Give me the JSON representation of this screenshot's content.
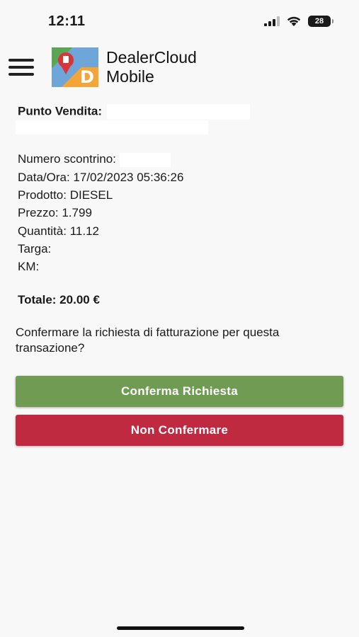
{
  "status_bar": {
    "time": "12:11",
    "battery": "28"
  },
  "header": {
    "title_line1": "DealerCloud",
    "title_line2": "Mobile"
  },
  "transaction": {
    "punto_vendita_label": "Punto Vendita:",
    "numero_scontrino_label": "Numero scontrino:",
    "data_ora": "Data/Ora: 17/02/2023 05:36:26",
    "prodotto": "Prodotto: DIESEL",
    "prezzo": "Prezzo: 1.799",
    "quantita": "Quantità: 11.12",
    "targa": "Targa:",
    "km": "KM:",
    "totale": "Totale: 20.00 €"
  },
  "question": "Confermare la richiesta di fatturazione per questa transazione?",
  "buttons": {
    "confirm_label": "Conferma Richiesta",
    "reject_label": "Non Confermare"
  },
  "colors": {
    "confirm": "#6f9b52",
    "reject": "#c02a40"
  }
}
